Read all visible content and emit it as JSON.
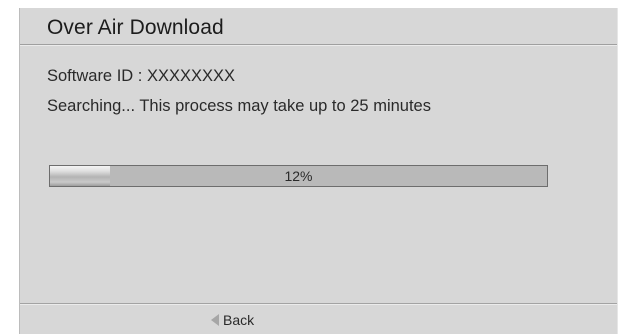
{
  "dialog": {
    "title": "Over Air Download",
    "software_id_line": "Software ID : XXXXXXXX",
    "status_line": "Searching... This process may take up to 25 minutes"
  },
  "progress": {
    "value_percent": 12,
    "label": "12%"
  },
  "footer": {
    "back_icon": "left-triangle-icon",
    "back_label": "Back"
  },
  "colors": {
    "panel_background": "#d7d7d7",
    "progress_track": "#b9b9b9",
    "text": "#2a2a2a"
  }
}
